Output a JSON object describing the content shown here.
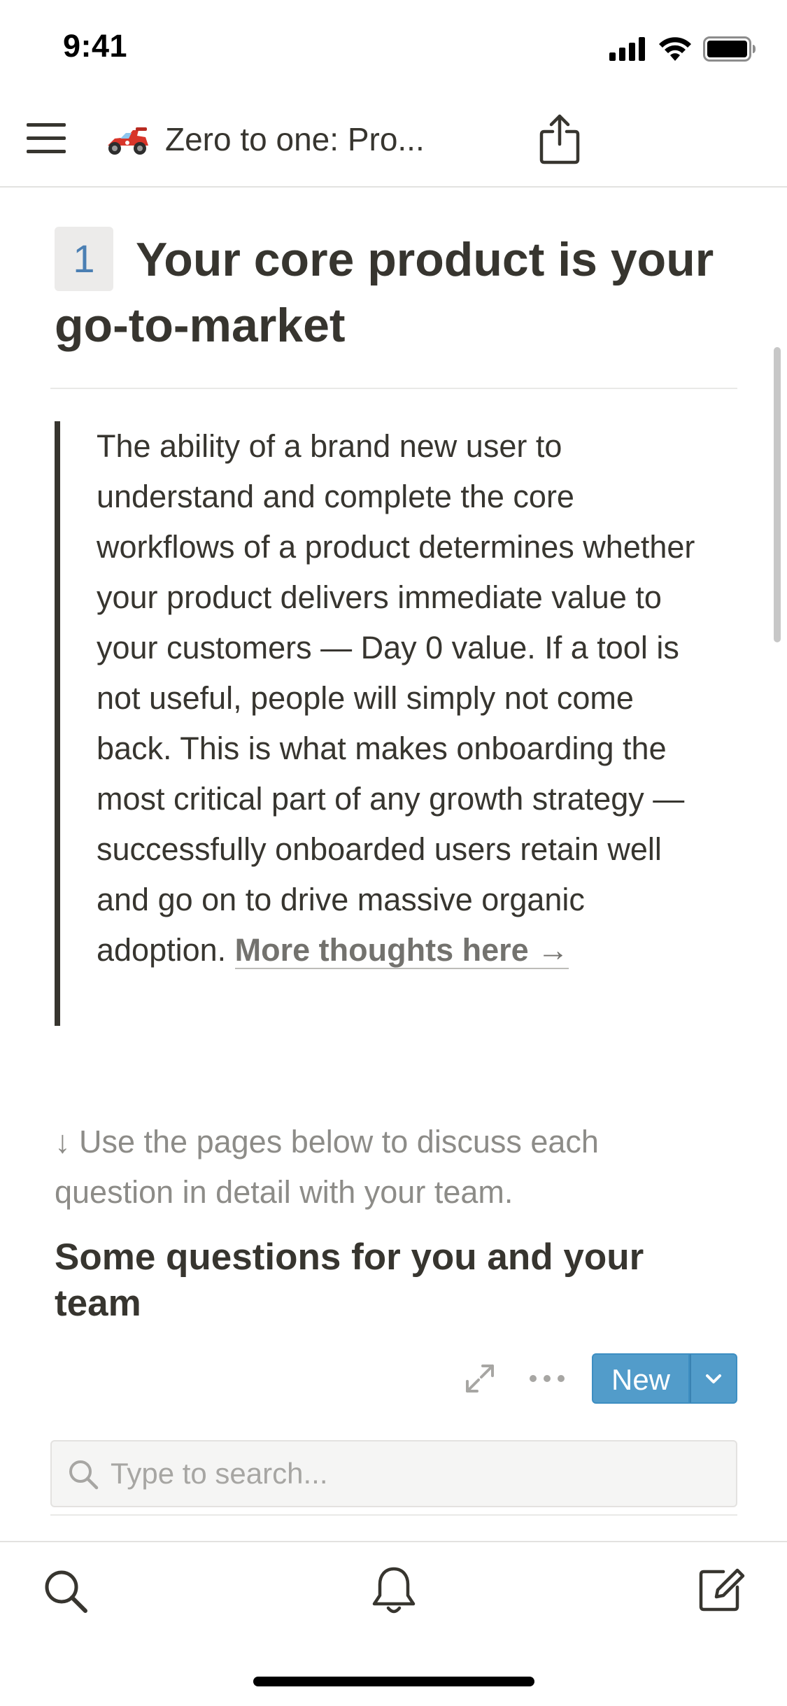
{
  "status_bar": {
    "time": "9:41"
  },
  "nav": {
    "title": "Zero to one: Pro...",
    "emoji": "race-car-icon"
  },
  "page": {
    "heading_number": "1",
    "heading": "Your core product is your go-to-market",
    "quote_text": "The ability of a brand new user to understand and complete the core workflows of a product determines whether your product delivers immediate value to your customers — Day 0 value. If a tool is not useful, people will simply not come back. This is what makes onboarding the most critical part of any growth strategy — successfully onboarded users retain well and go on to drive massive organic adoption. ",
    "quote_link": "More thoughts here →",
    "hint": "↓ Use the pages below to discuss each question in detail with your team.",
    "subheading": "Some questions for you and your team"
  },
  "database": {
    "new_label": "New",
    "search_placeholder": "Type to search..."
  },
  "colors": {
    "accent": "#529cca",
    "text": "#37352f",
    "muted": "#8d8c88",
    "number": "#4b7fb3"
  }
}
